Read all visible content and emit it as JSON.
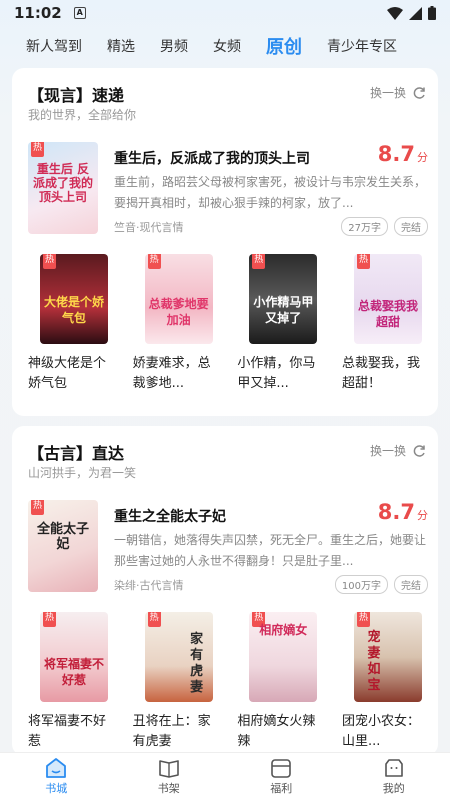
{
  "status": {
    "time": "11:02"
  },
  "tabs": [
    {
      "label": "新人驾到",
      "active": false
    },
    {
      "label": "精选",
      "active": false
    },
    {
      "label": "男频",
      "active": false
    },
    {
      "label": "女频",
      "active": false
    },
    {
      "label": "原创",
      "active": true
    },
    {
      "label": "青少年专区",
      "active": false
    }
  ],
  "section1": {
    "title": "【现言】速递",
    "subtitle": "我的世界，全部给你",
    "refresh_label": "换一换",
    "feature": {
      "cover_text": "重生后 反派成了我的顶头上司",
      "title": "重生后，反派成了我的顶头上司",
      "score": "8.7",
      "score_unit": "分",
      "description": "重生前，路昭芸父母被柯家害死，被设计与韦宗发生关系，要揭开真相时，却被心狠手辣的柯家，放了...",
      "meta": "竺音·现代言情",
      "word_count": "27万字",
      "status": "完结"
    },
    "books": [
      {
        "title": "神级大佬是个娇气包",
        "cover_text": "大佬是个娇气包"
      },
      {
        "title": "娇妻难求，总裁爹地...",
        "cover_text": "总裁爹地要加油"
      },
      {
        "title": "小作精，你马甲又掉...",
        "cover_text": "小作精马甲又掉了"
      },
      {
        "title": "总裁娶我，我超甜！",
        "cover_text": "总裁娶我我超甜"
      }
    ]
  },
  "section2": {
    "title": "【古言】直达",
    "subtitle": "山河拱手，为君一笑",
    "refresh_label": "换一换",
    "feature": {
      "cover_text": "全能太子妃",
      "title": "重生之全能太子妃",
      "score": "8.7",
      "score_unit": "分",
      "description": "一朝错信，她落得失声囚禁，死无全尸。重生之后，她要让那些害过她的人永世不得翻身！只是肚子里...",
      "meta": "染绯·古代言情",
      "word_count": "100万字",
      "status": "完结"
    },
    "books": [
      {
        "title": "将军福妻不好惹",
        "cover_text": "将军福妻不好惹"
      },
      {
        "title": "丑将在上：家有虎妻",
        "cover_text": "家有虎妻"
      },
      {
        "title": "相府嫡女火辣辣",
        "cover_text": "相府嫡女"
      },
      {
        "title": "团宠小农女：山里...",
        "cover_text": "宠妻如宝"
      }
    ]
  },
  "hot_badge": "热",
  "bottom_nav": [
    {
      "label": "书城",
      "icon": "bookstore-icon",
      "active": true
    },
    {
      "label": "书架",
      "icon": "bookshelf-icon",
      "active": false
    },
    {
      "label": "福利",
      "icon": "gift-icon",
      "active": false
    },
    {
      "label": "我的",
      "icon": "profile-icon",
      "active": false
    }
  ],
  "colors": {
    "accent": "#2b8cf0",
    "score": "#e94b4b",
    "hot": "#f05050"
  }
}
